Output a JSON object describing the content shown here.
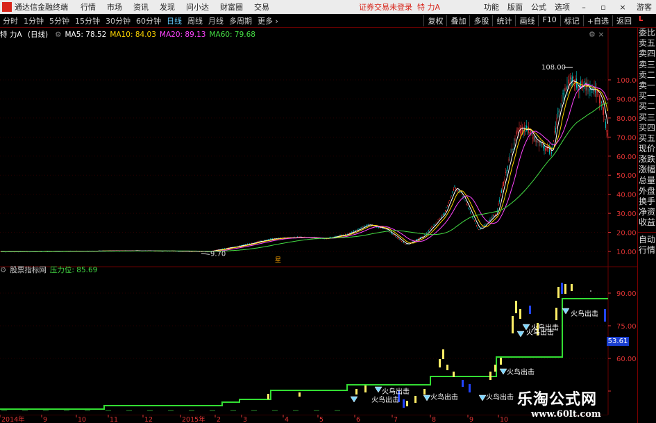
{
  "menubar": {
    "app_title": "通达信金融终端",
    "items": [
      "行情",
      "市场",
      "资讯",
      "发现",
      "问小达",
      "财富圈",
      "交易"
    ],
    "notice": "证券交易未登录",
    "stock": "特 力A",
    "right_items": [
      "功能",
      "版面",
      "公式",
      "选项"
    ],
    "guest": "游客"
  },
  "toolbar": {
    "periods": [
      "分时",
      "1分钟",
      "5分钟",
      "15分钟",
      "30分钟",
      "60分钟",
      "日线",
      "周线",
      "月线",
      "多周期",
      "更多"
    ],
    "active_period": "日线",
    "tools": [
      "复权",
      "叠加",
      "多股",
      "统计",
      "画线",
      "F10",
      "标记",
      "+自选",
      "返回"
    ]
  },
  "main_chart": {
    "stock_name": "特 力A",
    "period": "(日线)",
    "ma": [
      {
        "label": "MA5: 78.52",
        "color": "#ffffff"
      },
      {
        "label": "MA10: 84.03",
        "color": "#ffd700"
      },
      {
        "label": "MA20: 89.13",
        "color": "#ff44ff"
      },
      {
        "label": "MA60: 79.68",
        "color": "#44dd44"
      }
    ],
    "high_label": "108.00",
    "low_label": "9.70",
    "event_marker": "星",
    "y_ticks": [
      "100.00",
      "90.00",
      "80.00",
      "70.00",
      "60.00",
      "50.00",
      "40.00",
      "30.00",
      "20.00",
      "10.00"
    ]
  },
  "indicator": {
    "name": "股票指标网",
    "value_label": "压力位: 85.69",
    "price_badge": "53.61",
    "y_ticks": [
      "90.00",
      "75.00",
      "60.00"
    ],
    "signal_text": "火鸟出击",
    "x_labels": [
      "2014年",
      "9",
      "10",
      "11",
      "12",
      "2015年",
      "2",
      "3",
      "4",
      "5",
      "6",
      "7",
      "8",
      "9",
      "10"
    ]
  },
  "side_panel": {
    "badge": "L",
    "items": [
      "委比",
      "卖五",
      "卖四",
      "卖三",
      "卖二",
      "卖一",
      "买一",
      "买二",
      "买三",
      "买四",
      "买五",
      "现价",
      "涨跌",
      "涨幅",
      "总量",
      "外盘",
      "换手",
      "净资",
      "收益"
    ],
    "items2": [
      "自动",
      "行情"
    ]
  },
  "watermark": {
    "line1": "乐淘公式网",
    "line2": "www.60lt.com"
  },
  "colors": {
    "up": "#e03030",
    "down": "#00c0c0",
    "ma5": "#ffffff",
    "ma10": "#ffd700",
    "ma20": "#ff44ff",
    "ma60": "#44dd44",
    "pressure_line": "#33dd33",
    "grid": "#6a0000"
  }
}
